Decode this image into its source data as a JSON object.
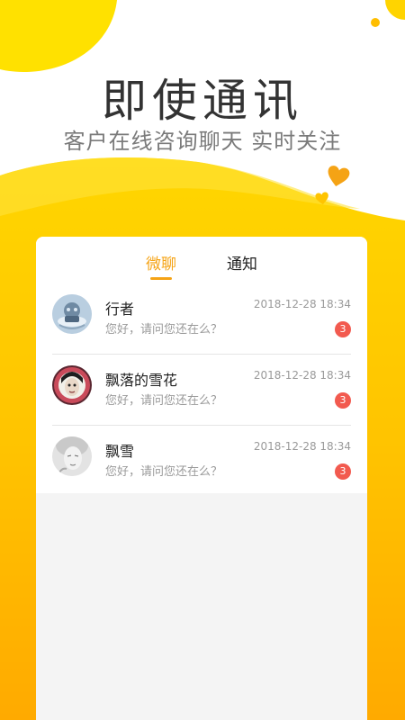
{
  "hero": {
    "title": "即使通讯",
    "subtitle": "客户在线咨询聊天  实时关注"
  },
  "tabs": [
    {
      "label": "微聊",
      "active": true
    },
    {
      "label": "通知",
      "active": false
    }
  ],
  "conversations": [
    {
      "name": "行者",
      "message": "您好，请问您还在么？",
      "time": "2018-12-28 18:34",
      "unread": "3",
      "avatar": "robot-avatar"
    },
    {
      "name": "飘落的雪花",
      "message": "您好，请问您还在么？",
      "time": "2018-12-28 18:34",
      "unread": "3",
      "avatar": "face-avatar"
    },
    {
      "name": "飘雪",
      "message": "您好，请问您还在么？",
      "time": "2018-12-28 18:34",
      "unread": "3",
      "avatar": "sketch-avatar"
    }
  ],
  "colors": {
    "accent": "#f5a315",
    "yellow": "#ffd400",
    "orange": "#ffb300",
    "badge": "#f25a4f"
  },
  "icons": [
    "heart-icon",
    "heart-icon"
  ]
}
